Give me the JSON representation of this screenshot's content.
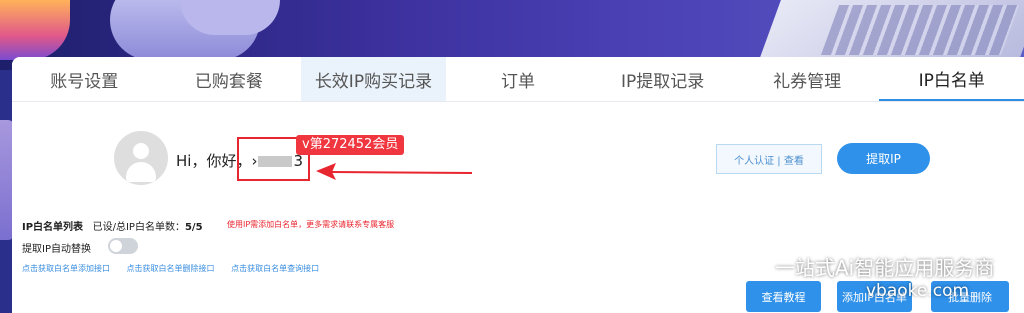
{
  "tabs": [
    {
      "label": "账号设置"
    },
    {
      "label": "已购套餐"
    },
    {
      "label": "长效IP购买记录"
    },
    {
      "label": "订单"
    },
    {
      "label": "IP提取记录"
    },
    {
      "label": "礼券管理"
    },
    {
      "label": "IP白名单"
    }
  ],
  "user": {
    "greeting": "Hi，你好，",
    "uid_prefix": "›",
    "uid_suffix": "3",
    "member_badge": "v第272452会员"
  },
  "actions": {
    "verify_label": "个人认证 | 查看",
    "extract_label": "提取IP"
  },
  "whitelist": {
    "title": "IP白名单列表",
    "count_label": "已设/总IP白名单数：",
    "count_value": "5/5",
    "warning": "使用IP需添加白名单，更多需求请联系专属客服",
    "auto_replace_label": "提取IP自动替换",
    "auto_replace_on": false,
    "links": [
      "点击获取白名单添加接口",
      "点击获取白名单删除接口",
      "点击获取白名单查询接口"
    ]
  },
  "buttons": {
    "tutorial": "查看教程",
    "add": "添加IP白名单",
    "batch": "批量删除"
  },
  "watermark": {
    "line1": "一站式Ai智能应用服务商",
    "line2": "vbaoke.com"
  },
  "colors": {
    "accent": "#2f91ea",
    "alert": "#e8262f"
  }
}
